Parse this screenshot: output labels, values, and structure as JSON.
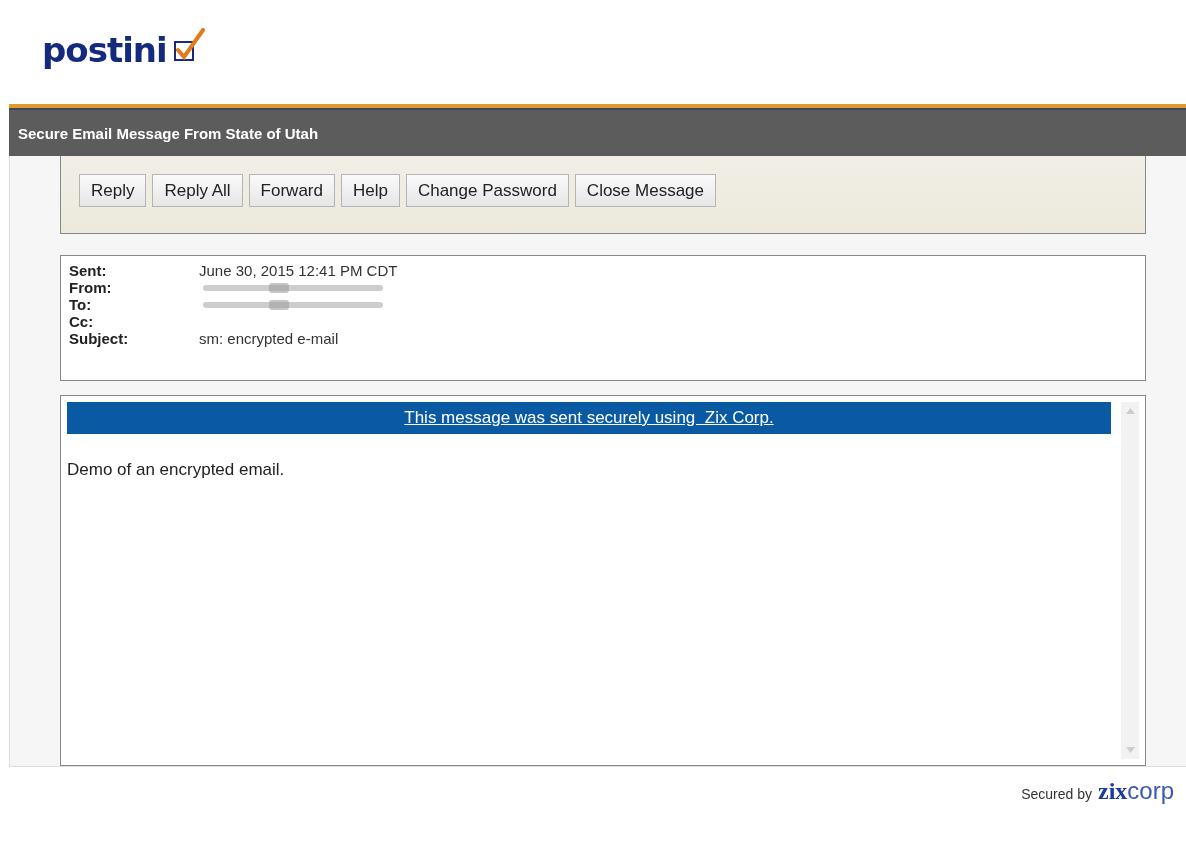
{
  "logo": "postini",
  "title_bar": "Secure Email Message From State of Utah",
  "buttons": [
    "Reply",
    "Reply All",
    "Forward",
    "Help",
    "Change Password",
    "Close Message"
  ],
  "headers": [
    {
      "label": "Sent:",
      "value": "June 30, 2015 12:41 PM CDT",
      "kind": "text"
    },
    {
      "label": "From:",
      "kind": "redacted"
    },
    {
      "label": "To:",
      "kind": "redacted"
    },
    {
      "label": "Cc:",
      "kind": "empty"
    },
    {
      "label": "Subject:",
      "value": "sm: encrypted e-mail",
      "kind": "text"
    }
  ],
  "banner_link": "This message was sent securely using  Zix Corp.",
  "body": "Demo of an encrypted email.",
  "footer": {
    "text": "Secured by",
    "brand_bold": "zix",
    "brand_light": "corp"
  }
}
